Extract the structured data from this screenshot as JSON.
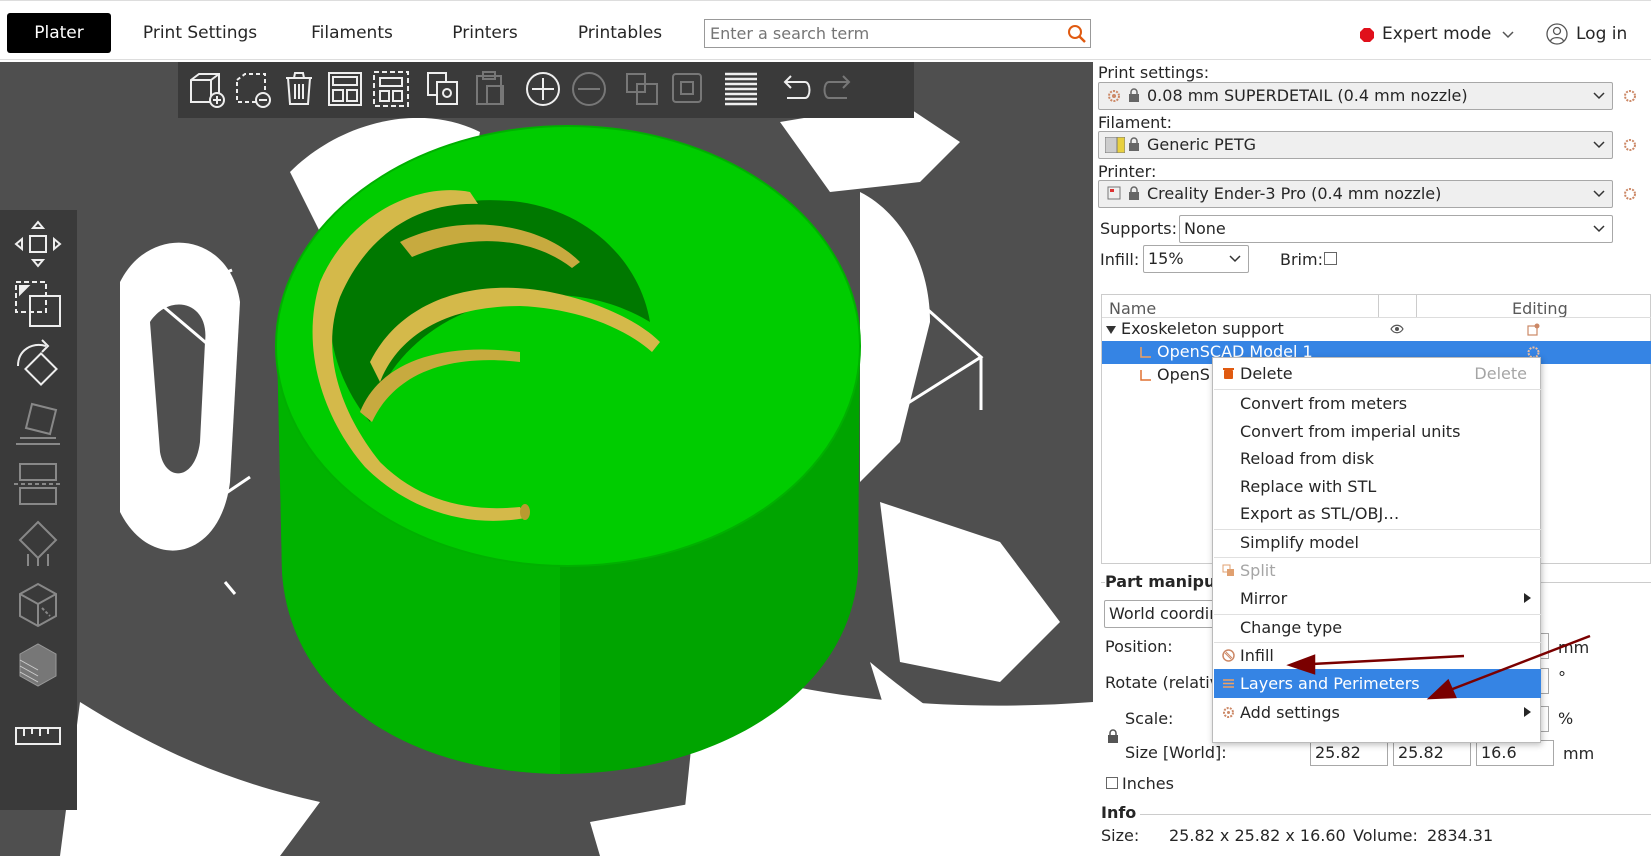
{
  "tabs": [
    "Plater",
    "Print Settings",
    "Filaments",
    "Printers",
    "Printables"
  ],
  "search": {
    "placeholder": "Enter a search term"
  },
  "mode": {
    "label": "Expert mode",
    "color": "#e0101b"
  },
  "login": "Log in",
  "right": {
    "print_settings_label": "Print settings:",
    "print_settings_value": "0.08 mm SUPERDETAIL (0.4 mm nozzle)",
    "filament_label": "Filament:",
    "filament_value": "Generic PETG",
    "printer_label": "Printer:",
    "printer_value": "Creality Ender-3 Pro (0.4 mm nozzle)",
    "supports_label": "Supports:",
    "supports_value": "None",
    "infill_label": "Infill:",
    "infill_value": "15%",
    "brim_label": "Brim:",
    "list_headers": {
      "name": "Name",
      "editing": "Editing"
    },
    "objects": [
      {
        "name": "Exoskeleton support"
      },
      {
        "name": "OpenSCAD Model 1"
      },
      {
        "name": "OpenS"
      }
    ],
    "part_manip_title": "Part manipula",
    "coord_value": "World coordin",
    "position_label": "Position:",
    "rotate_label": "Rotate (relativ",
    "scale_label": "Scale:",
    "size_label": "Size [World]:",
    "size_values": [
      "25.82",
      "25.82",
      "16.6"
    ],
    "unit_mm": "mm",
    "unit_deg": "°",
    "unit_pct": "%",
    "inches_label": "Inches",
    "info_title": "Info",
    "info_size_label": "Size:",
    "info_size_value": "25.82 x 25.82 x 16.60",
    "info_volume_label": "Volume:",
    "info_volume_value": "2834.31"
  },
  "context_menu": {
    "items": [
      {
        "label": "Delete",
        "shortcut": "Delete"
      },
      {
        "label": "Convert from meters"
      },
      {
        "label": "Convert from imperial units"
      },
      {
        "label": "Reload from disk"
      },
      {
        "label": "Replace with STL"
      },
      {
        "label": "Export as STL/OBJ…"
      },
      {
        "label": "Simplify model"
      },
      {
        "label": "Split"
      },
      {
        "label": "Mirror"
      },
      {
        "label": "Change type"
      },
      {
        "label": "Infill"
      },
      {
        "label": "Layers and Perimeters"
      },
      {
        "label": "Add settings"
      }
    ]
  },
  "colors": {
    "accent": "#3584e4",
    "model_green": "#00c800",
    "model_yellow": "#d4b94a",
    "viewport_bg": "#4f4f4f",
    "arrow": "#7a0000"
  }
}
